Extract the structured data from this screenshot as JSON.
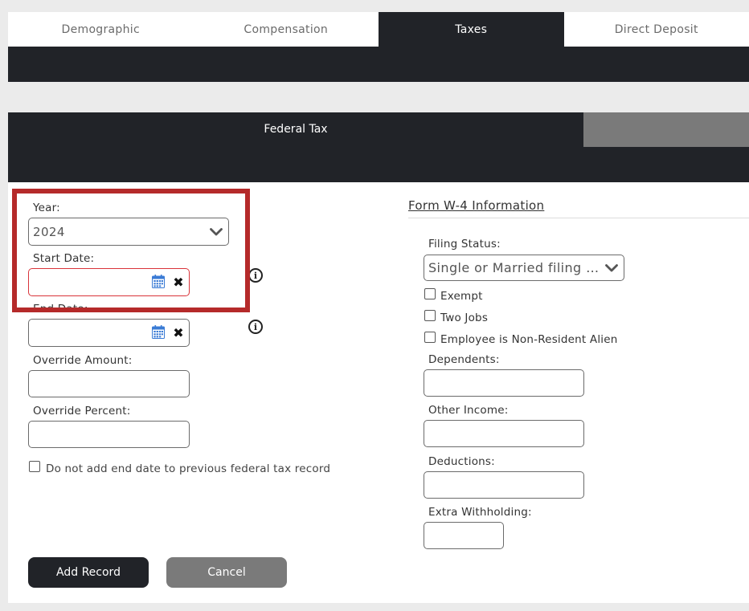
{
  "tabs": [
    {
      "label": "Demographic"
    },
    {
      "label": "Compensation"
    },
    {
      "label": "Taxes"
    },
    {
      "label": "Direct Deposit"
    }
  ],
  "section": {
    "title": "Federal Tax"
  },
  "left_form": {
    "year_label": "Year:",
    "year_value": "2024",
    "start_date_label": "Start Date:",
    "start_date_value": "",
    "end_date_label": "End Date:",
    "end_date_value": "",
    "override_amount_label": "Override Amount:",
    "override_amount_value": "",
    "override_percent_label": "Override Percent:",
    "override_percent_value": "",
    "no_end_date_label": "Do not add end date to previous federal tax record",
    "no_end_date_checked": false
  },
  "w4": {
    "title": "Form W-4 Information",
    "filing_status_label": "Filing Status:",
    "filing_status_value": "Single or Married filing s...",
    "exempt_label": "Exempt",
    "two_jobs_label": "Two Jobs",
    "nonresident_label": "Employee is Non-Resident Alien",
    "dependents_label": "Dependents:",
    "other_income_label": "Other Income:",
    "deductions_label": "Deductions:",
    "extra_withholding_label": "Extra Withholding:"
  },
  "buttons": {
    "add_record": "Add Record",
    "cancel": "Cancel"
  },
  "colors": {
    "dark": "#212328",
    "grey_button": "#7a7a7a",
    "highlight_red": "#b52a2a",
    "error_red": "#d9343a",
    "calendar_blue": "#3a7bd5"
  },
  "icons": {
    "calendar": "calendar-icon",
    "clear": "close-icon",
    "info": "info-icon",
    "dropdown": "chevron-down-icon"
  }
}
